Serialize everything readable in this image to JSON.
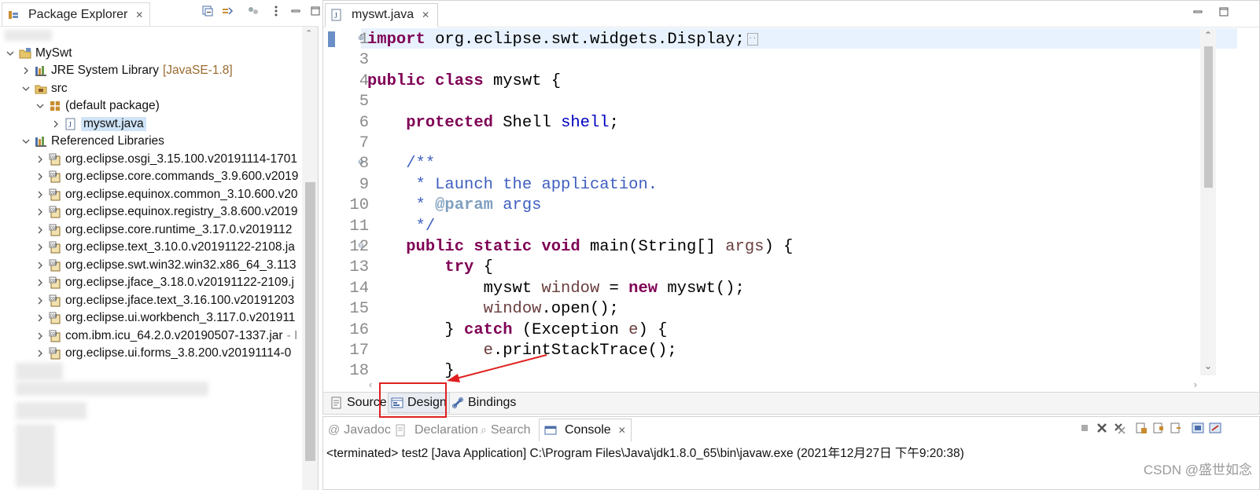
{
  "package_explorer": {
    "title": "Package Explorer",
    "tree": [
      {
        "label": "MySwt",
        "decoration": "",
        "level": 0,
        "expanded": true,
        "icon": "project-icon"
      },
      {
        "label": "JRE System Library",
        "decoration": "[JavaSE-1.8]",
        "level": 1,
        "expanded": false,
        "icon": "library-icon"
      },
      {
        "label": "src",
        "decoration": "",
        "level": 1,
        "expanded": true,
        "icon": "source-folder-icon"
      },
      {
        "label": "(default package)",
        "decoration": "",
        "level": 2,
        "expanded": true,
        "icon": "package-icon"
      },
      {
        "label": "myswt.java",
        "decoration": "",
        "level": 3,
        "expanded": false,
        "icon": "java-file-icon",
        "selected": true
      },
      {
        "label": "Referenced Libraries",
        "decoration": "",
        "level": 1,
        "expanded": true,
        "icon": "library-icon"
      },
      {
        "label": "org.eclipse.osgi_3.15.100.v20191114-1701",
        "decoration": "",
        "level": 2,
        "expanded": false,
        "icon": "jar-icon"
      },
      {
        "label": "org.eclipse.core.commands_3.9.600.v2019",
        "decoration": "",
        "level": 2,
        "expanded": false,
        "icon": "jar-icon"
      },
      {
        "label": "org.eclipse.equinox.common_3.10.600.v20",
        "decoration": "",
        "level": 2,
        "expanded": false,
        "icon": "jar-icon"
      },
      {
        "label": "org.eclipse.equinox.registry_3.8.600.v2019",
        "decoration": "",
        "level": 2,
        "expanded": false,
        "icon": "jar-icon"
      },
      {
        "label": "org.eclipse.core.runtime_3.17.0.v2019112",
        "decoration": "",
        "level": 2,
        "expanded": false,
        "icon": "jar-icon"
      },
      {
        "label": "org.eclipse.text_3.10.0.v20191122-2108.ja",
        "decoration": "",
        "level": 2,
        "expanded": false,
        "icon": "jar-icon"
      },
      {
        "label": "org.eclipse.swt.win32.win32.x86_64_3.113",
        "decoration": "",
        "level": 2,
        "expanded": false,
        "icon": "jar-icon"
      },
      {
        "label": "org.eclipse.jface_3.18.0.v20191122-2109.j",
        "decoration": "",
        "level": 2,
        "expanded": false,
        "icon": "jar-icon"
      },
      {
        "label": "org.eclipse.jface.text_3.16.100.v20191203",
        "decoration": "",
        "level": 2,
        "expanded": false,
        "icon": "jar-icon"
      },
      {
        "label": "org.eclipse.ui.workbench_3.117.0.v201911",
        "decoration": "",
        "level": 2,
        "expanded": false,
        "icon": "jar-icon"
      },
      {
        "label": "com.ibm.icu_64.2.0.v20190507-1337.jar",
        "decoration": "- I",
        "level": 2,
        "expanded": false,
        "icon": "jar-icon"
      },
      {
        "label": "org.eclipse.ui.forms_3.8.200.v20191114-0",
        "decoration": "",
        "level": 2,
        "expanded": false,
        "icon": "jar-icon"
      }
    ]
  },
  "editor": {
    "tab_label": "myswt.java",
    "lines": [
      {
        "n": "1",
        "mark": "+",
        "tokens": [
          [
            "k",
            "import"
          ],
          [
            "n",
            " org.eclipse.swt.widgets.Display;"
          ]
        ],
        "folded": true
      },
      {
        "n": "3",
        "mark": "",
        "tokens": []
      },
      {
        "n": "4",
        "mark": "",
        "tokens": [
          [
            "k",
            "public"
          ],
          [
            "n",
            " "
          ],
          [
            "k",
            "class"
          ],
          [
            "n",
            " myswt {"
          ]
        ]
      },
      {
        "n": "5",
        "mark": "",
        "tokens": []
      },
      {
        "n": "6",
        "mark": "",
        "tokens": [
          [
            "n",
            "    "
          ],
          [
            "k",
            "protected"
          ],
          [
            "n",
            " Shell "
          ],
          [
            "f",
            "shell"
          ],
          [
            "n",
            ";"
          ]
        ]
      },
      {
        "n": "7",
        "mark": "",
        "tokens": []
      },
      {
        "n": "8",
        "mark": "-",
        "tokens": [
          [
            "n",
            "    "
          ],
          [
            "jd",
            "/**"
          ]
        ]
      },
      {
        "n": "9",
        "mark": "",
        "tokens": [
          [
            "n",
            "     "
          ],
          [
            "jd",
            "* Launch the application."
          ]
        ]
      },
      {
        "n": "10",
        "mark": "",
        "tokens": [
          [
            "n",
            "     "
          ],
          [
            "jd",
            "* "
          ],
          [
            "jt",
            "@param"
          ],
          [
            "jd",
            " args"
          ]
        ]
      },
      {
        "n": "11",
        "mark": "",
        "tokens": [
          [
            "n",
            "     "
          ],
          [
            "jd",
            "*/"
          ]
        ]
      },
      {
        "n": "12",
        "mark": "-",
        "tokens": [
          [
            "n",
            "    "
          ],
          [
            "k",
            "public"
          ],
          [
            "n",
            " "
          ],
          [
            "k",
            "static"
          ],
          [
            "n",
            " "
          ],
          [
            "k",
            "void"
          ],
          [
            "n",
            " main(String[] "
          ],
          [
            "v",
            "args"
          ],
          [
            "n",
            ") {"
          ]
        ]
      },
      {
        "n": "13",
        "mark": "",
        "tokens": [
          [
            "n",
            "        "
          ],
          [
            "k",
            "try"
          ],
          [
            "n",
            " {"
          ]
        ]
      },
      {
        "n": "14",
        "mark": "",
        "tokens": [
          [
            "n",
            "            myswt "
          ],
          [
            "v",
            "window"
          ],
          [
            "n",
            " = "
          ],
          [
            "k",
            "new"
          ],
          [
            "n",
            " myswt();"
          ]
        ]
      },
      {
        "n": "15",
        "mark": "",
        "tokens": [
          [
            "n",
            "            "
          ],
          [
            "v",
            "window"
          ],
          [
            "n",
            ".open();"
          ]
        ]
      },
      {
        "n": "16",
        "mark": "",
        "tokens": [
          [
            "n",
            "        } "
          ],
          [
            "k",
            "catch"
          ],
          [
            "n",
            " (Exception "
          ],
          [
            "v",
            "e"
          ],
          [
            "n",
            ") {"
          ]
        ]
      },
      {
        "n": "17",
        "mark": "",
        "tokens": [
          [
            "n",
            "            "
          ],
          [
            "v",
            "e"
          ],
          [
            "n",
            ".printStackTrace();"
          ]
        ]
      },
      {
        "n": "18",
        "mark": "",
        "tokens": [
          [
            "n",
            "        }"
          ]
        ]
      }
    ],
    "bottom_tabs": [
      {
        "label": "Source",
        "icon": "source-icon"
      },
      {
        "label": "Design",
        "icon": "design-icon"
      },
      {
        "label": "Bindings",
        "icon": "bindings-icon"
      }
    ]
  },
  "console": {
    "tabs": [
      {
        "label": "Javadoc",
        "icon": "javadoc-icon",
        "active": false
      },
      {
        "label": "Declaration",
        "icon": "declaration-icon",
        "active": false
      },
      {
        "label": "Search",
        "icon": "search-icon",
        "active": false
      },
      {
        "label": "Console",
        "icon": "console-icon",
        "active": true
      }
    ],
    "status": "<terminated> test2 [Java Application] C:\\Program Files\\Java\\jdk1.8.0_65\\bin\\javaw.exe (2021年12月27日 下午9:20:38)"
  },
  "watermark": "CSDN @盛世如念",
  "colors": {
    "keyword": "#7f0055",
    "field": "#0000c0",
    "local_var": "#6a3e3e",
    "javadoc": "#3f5fbf",
    "annotation_box": "#e02020"
  }
}
